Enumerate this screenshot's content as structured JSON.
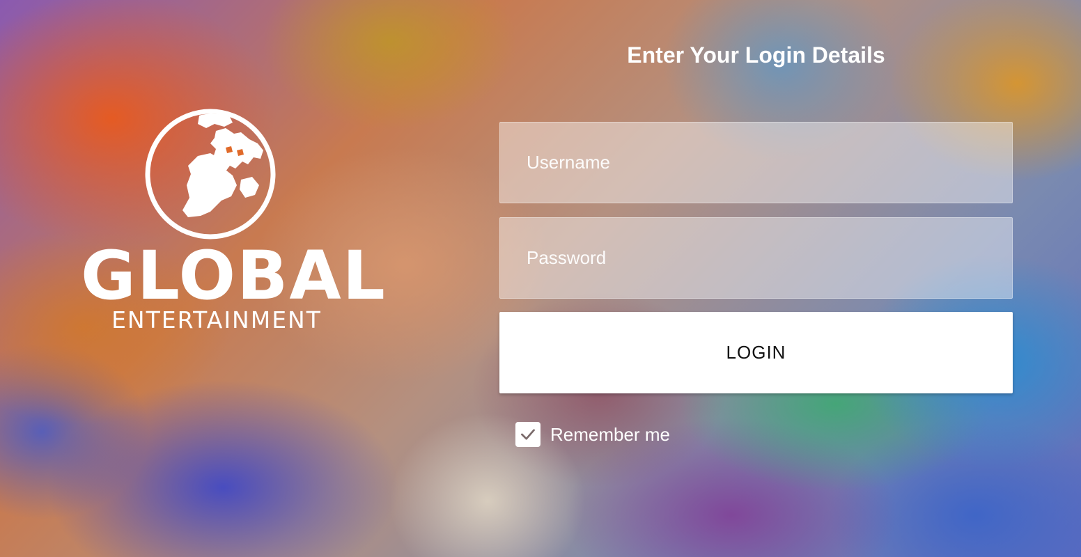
{
  "brand": {
    "name": "GLOBAL",
    "tagline": "ENTERTAINMENT"
  },
  "login_form": {
    "title": "Enter Your Login Details",
    "username_placeholder": "Username",
    "password_placeholder": "Password",
    "login_label": "LOGIN",
    "remember_label": "Remember me",
    "remember_checked": true
  },
  "colors": {
    "field_background": "rgba(255,255,255,0.42)",
    "button_background": "#ffffff",
    "text": "#ffffff",
    "check_mark": "#7a6a6a"
  },
  "icons": {
    "logo": "globe-icon",
    "checkbox": "check-icon"
  }
}
